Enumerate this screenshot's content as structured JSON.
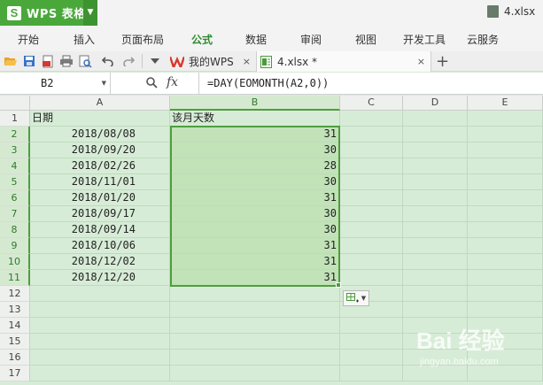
{
  "app": {
    "name": "WPS 表格",
    "logo_letter": "S",
    "document_title": "4.xlsx"
  },
  "menu": [
    "开始",
    "插入",
    "页面布局",
    "公式",
    "数据",
    "审阅",
    "视图",
    "开发工具",
    "云服务"
  ],
  "menu_active": "公式",
  "tabs": [
    {
      "label": "我的WPS",
      "close": "×"
    },
    {
      "label": "4.xlsx *",
      "close": "×"
    }
  ],
  "formula_bar": {
    "name_box": "B2",
    "fx_label": "fx",
    "formula": "=DAY(EOMONTH(A2,0))"
  },
  "columns": [
    "A",
    "B",
    "C",
    "D",
    "E"
  ],
  "rows": [
    "1",
    "2",
    "3",
    "4",
    "5",
    "6",
    "7",
    "8",
    "9",
    "10",
    "11",
    "12",
    "13",
    "14",
    "15",
    "16",
    "17"
  ],
  "table": {
    "header_a": "日期",
    "header_b": "该月天数",
    "dates": [
      "2018/08/08",
      "2018/09/20",
      "2018/02/26",
      "2018/11/01",
      "2018/01/20",
      "2018/09/17",
      "2018/09/14",
      "2018/10/06",
      "2018/12/02",
      "2018/12/20"
    ],
    "days": [
      "31",
      "30",
      "28",
      "30",
      "31",
      "30",
      "30",
      "31",
      "31",
      "31"
    ]
  },
  "watermark": {
    "main": "Bai 经验",
    "sub": "jingyan.baidu.com"
  }
}
